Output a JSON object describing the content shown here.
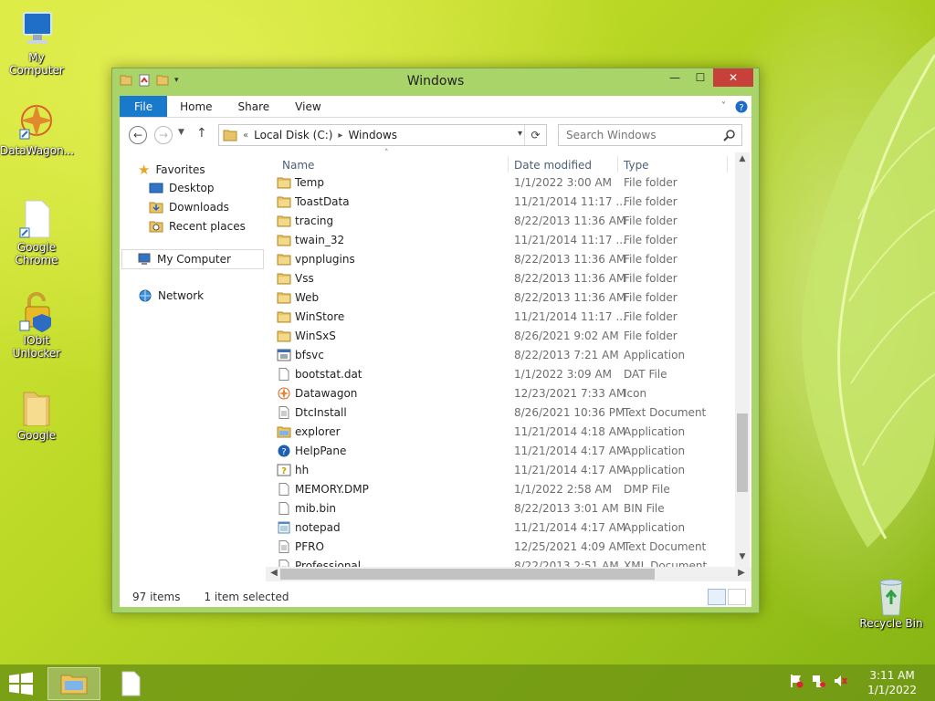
{
  "desktop": {
    "icons": [
      {
        "label": "My Computer"
      },
      {
        "label": "DataWagon..."
      },
      {
        "label": "Google Chrome"
      },
      {
        "label": "IObit Unlocker"
      },
      {
        "label": "Google"
      },
      {
        "label": "Recycle Bin"
      }
    ]
  },
  "window": {
    "title": "Windows",
    "controls": {
      "minimize": "—",
      "maximize": "☐",
      "close": "✕"
    },
    "ribbon_tabs": [
      "File",
      "Home",
      "Share",
      "View"
    ],
    "address": {
      "prefix": "«",
      "crumbs": [
        "Local Disk (C:)",
        "Windows"
      ]
    },
    "search_placeholder": "Search Windows",
    "nav": {
      "favorites": "Favorites",
      "desktop": "Desktop",
      "downloads": "Downloads",
      "recent": "Recent places",
      "computer": "My Computer",
      "network": "Network"
    },
    "columns": {
      "name": "Name",
      "date": "Date modified",
      "type": "Type"
    },
    "files": [
      {
        "name": "Temp",
        "date": "1/1/2022 3:00 AM",
        "type": "File folder",
        "icon": "folder"
      },
      {
        "name": "ToastData",
        "date": "11/21/2014 11:17 ...",
        "type": "File folder",
        "icon": "folder"
      },
      {
        "name": "tracing",
        "date": "8/22/2013 11:36 AM",
        "type": "File folder",
        "icon": "folder"
      },
      {
        "name": "twain_32",
        "date": "11/21/2014 11:17 ...",
        "type": "File folder",
        "icon": "folder"
      },
      {
        "name": "vpnplugins",
        "date": "8/22/2013 11:36 AM",
        "type": "File folder",
        "icon": "folder"
      },
      {
        "name": "Vss",
        "date": "8/22/2013 11:36 AM",
        "type": "File folder",
        "icon": "folder"
      },
      {
        "name": "Web",
        "date": "8/22/2013 11:36 AM",
        "type": "File folder",
        "icon": "folder"
      },
      {
        "name": "WinStore",
        "date": "11/21/2014 11:17 ...",
        "type": "File folder",
        "icon": "folder"
      },
      {
        "name": "WinSxS",
        "date": "8/26/2021 9:02 AM",
        "type": "File folder",
        "icon": "folder"
      },
      {
        "name": "bfsvc",
        "date": "8/22/2013 7:21 AM",
        "type": "Application",
        "icon": "app"
      },
      {
        "name": "bootstat.dat",
        "date": "1/1/2022 3:09 AM",
        "type": "DAT File",
        "icon": "file"
      },
      {
        "name": "Datawagon",
        "date": "12/23/2021 7:33 AM",
        "type": "Icon",
        "icon": "star"
      },
      {
        "name": "DtcInstall",
        "date": "8/26/2021 10:36 PM",
        "type": "Text Document",
        "icon": "text"
      },
      {
        "name": "explorer",
        "date": "11/21/2014 4:18 AM",
        "type": "Application",
        "icon": "explorer"
      },
      {
        "name": "HelpPane",
        "date": "11/21/2014 4:17 AM",
        "type": "Application",
        "icon": "help"
      },
      {
        "name": "hh",
        "date": "11/21/2014 4:17 AM",
        "type": "Application",
        "icon": "hh"
      },
      {
        "name": "MEMORY.DMP",
        "date": "1/1/2022 2:58 AM",
        "type": "DMP File",
        "icon": "file"
      },
      {
        "name": "mib.bin",
        "date": "8/22/2013 3:01 AM",
        "type": "BIN File",
        "icon": "file"
      },
      {
        "name": "notepad",
        "date": "11/21/2014 4:17 AM",
        "type": "Application",
        "icon": "notepad"
      },
      {
        "name": "PFRO",
        "date": "12/25/2021 4:09 AM",
        "type": "Text Document",
        "icon": "text"
      },
      {
        "name": "Professional",
        "date": "8/22/2013 2:51 AM",
        "type": "XML Document",
        "icon": "xml"
      }
    ],
    "status": {
      "items": "97 items",
      "selected": "1 item selected"
    }
  },
  "taskbar": {
    "clock_time": "3:11 AM",
    "clock_date": "1/1/2022"
  }
}
